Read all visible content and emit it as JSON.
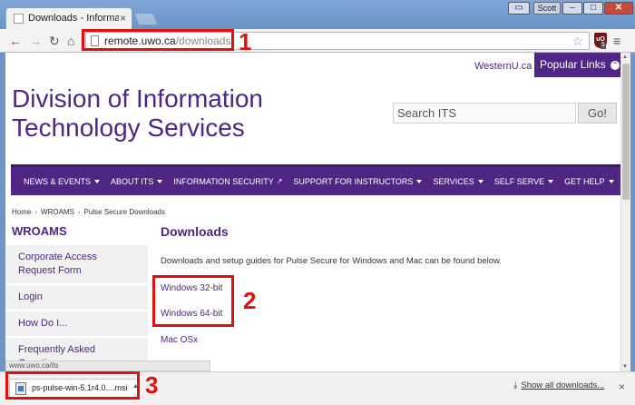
{
  "browser": {
    "tab_title": "Downloads - Information",
    "tab_close": "×",
    "user_label": "Scott",
    "url_host": "remote.uwo.ca",
    "url_path": "/downloads/",
    "ext_label": "uO",
    "ext_badge": "1"
  },
  "annotations": [
    "1",
    "2",
    "3"
  ],
  "header": {
    "westernu_link": "WesternU.ca",
    "popular_links": "Popular Links",
    "site_title_line1": "Division of Information",
    "site_title_line2": "Technology Services",
    "search_placeholder": "Search ITS",
    "search_button": "Go!"
  },
  "mainnav": {
    "items": [
      "NEWS & EVENTS",
      "ABOUT ITS",
      "INFORMATION SECURITY",
      "SUPPORT FOR INSTRUCTORS",
      "SERVICES",
      "SELF SERVE",
      "GET HELP"
    ]
  },
  "breadcrumb": [
    "Home",
    "WROAMS",
    "Pulse Secure Downloads"
  ],
  "sidebar": {
    "heading": "WROAMS",
    "items": [
      "Corporate Access Request Form",
      "Login",
      "How Do I...",
      "Frequently Asked Questions"
    ]
  },
  "content": {
    "heading": "Downloads",
    "intro": "Downloads and setup guides for Pulse Secure for Windows and Mac can be found below.",
    "links": [
      "Windows 32-bit",
      "Windows 64-bit",
      "Mac OSx"
    ]
  },
  "status_url": "www.uwo.ca/its",
  "download_shelf": {
    "file_name": "ps-pulse-win-5.1r4.0....msi",
    "show_all": "Show all downloads...",
    "close": "×"
  },
  "colors": {
    "western_purple": "#4f2683",
    "annotation_red": "#e01010"
  }
}
